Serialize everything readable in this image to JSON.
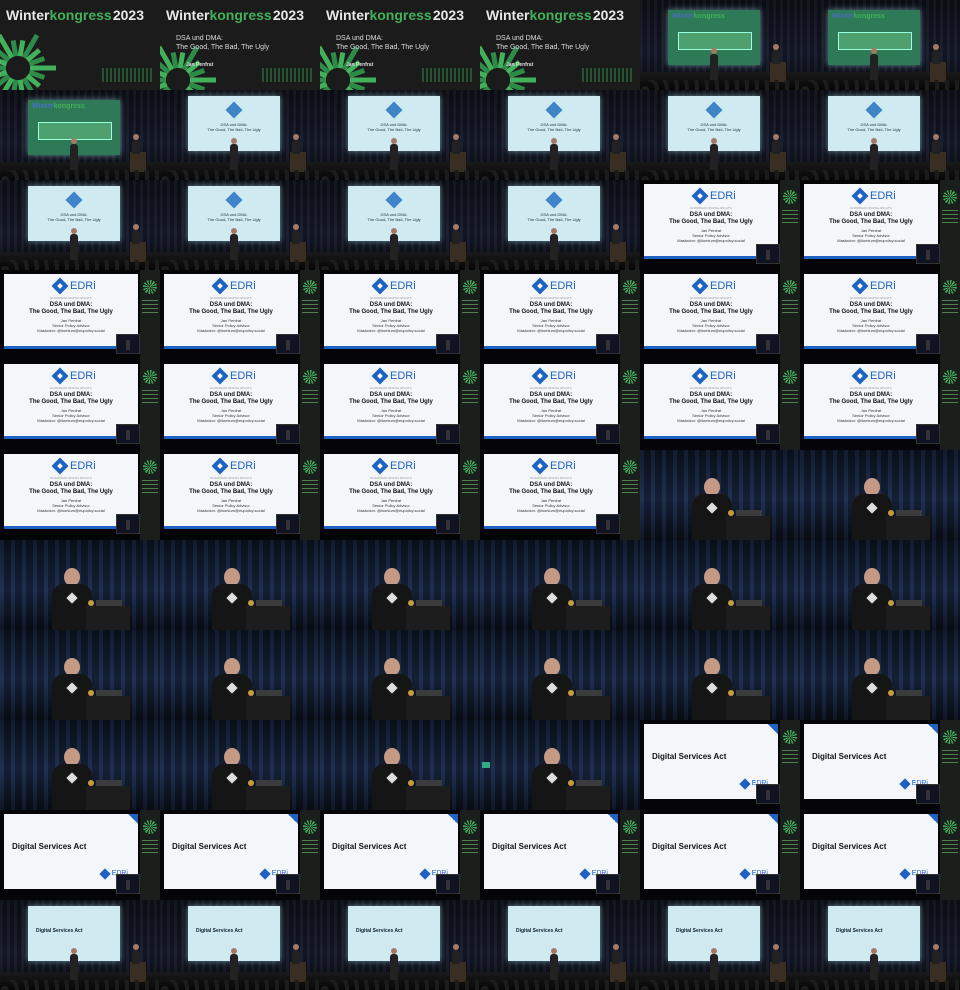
{
  "title_card": {
    "brand_part1": "Winter",
    "brand_part2": "kongress",
    "year": "2023",
    "slide_title_line1": "DSA und DMA:",
    "slide_title_line2": "The Good, The Bad, The Ugly",
    "speaker": "Jan Penfrat",
    "sponsor_logo": "Digitale Gesellschaft"
  },
  "edri_slide": {
    "brand": "EDRi",
    "tagline": "EUROPEAN DIGITAL RIGHTS",
    "title_line1": "DSA und DMA:",
    "title_line2": "The Good, The Bad, The Ugly",
    "name": "Jan Penfrat",
    "role": "Senior Policy Advisor",
    "mastodon": "Mastodon: @ilumium@eupolicy.social"
  },
  "dsa_slide": {
    "heading": "Digital Services Act",
    "brand": "EDRi"
  },
  "tiles": [
    "title",
    "title-sub",
    "title-sub",
    "title-sub",
    "stage-green",
    "stage-green",
    "stage-green-wide",
    "stage-edri",
    "stage-edri",
    "stage-edri",
    "stage-edri",
    "stage-edri",
    "stage-edri",
    "stage-edri",
    "stage-edri",
    "stage-edri",
    "edri",
    "edri",
    "edri",
    "edri",
    "edri",
    "edri",
    "edri",
    "edri",
    "edri",
    "edri",
    "edri",
    "edri",
    "edri",
    "edri",
    "edri",
    "edri",
    "edri",
    "edri",
    "speaker",
    "speaker",
    "speaker",
    "speaker",
    "speaker",
    "speaker",
    "speaker",
    "speaker",
    "speaker",
    "speaker",
    "speaker",
    "speaker",
    "speaker",
    "speaker",
    "speaker",
    "speaker",
    "speaker",
    "speaker-thumb",
    "dsa",
    "dsa",
    "dsa",
    "dsa",
    "dsa",
    "dsa",
    "dsa",
    "dsa",
    "stage-dsa",
    "stage-dsa",
    "stage-dsa",
    "stage-dsa",
    "stage-dsa",
    "stage-dsa"
  ],
  "colors": {
    "accent_green": "#43b05c",
    "edri_blue": "#1e63c4",
    "background": "#000000"
  }
}
